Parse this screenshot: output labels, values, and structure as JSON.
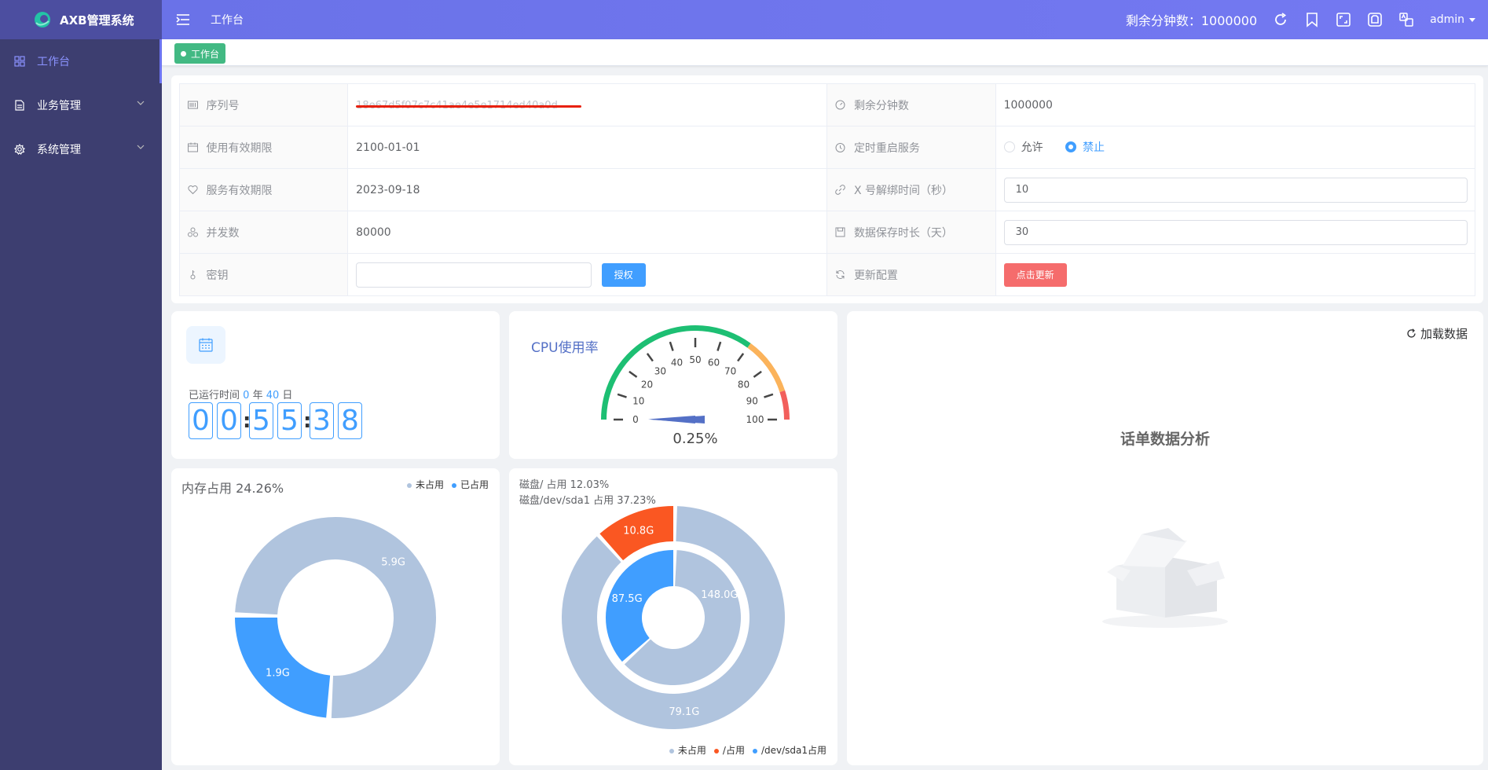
{
  "app": {
    "title": "AXB管理系统"
  },
  "sidebar": {
    "items": [
      {
        "label": "工作台",
        "icon": "dashboard-icon",
        "active": true
      },
      {
        "label": "业务管理",
        "icon": "document-icon",
        "active": false
      },
      {
        "label": "系统管理",
        "icon": "gear-icon",
        "active": false
      }
    ]
  },
  "header": {
    "breadcrumb": "工作台",
    "remaining_minutes": "剩余分钟数：1000000",
    "user": "admin"
  },
  "tags": {
    "active_tag": "工作台"
  },
  "info": {
    "serial_label": "序列号",
    "serial_value": "18e67d5f07c7c41ae4e5e1714ed40a0d",
    "remain_label": "剩余分钟数",
    "remain_value": "1000000",
    "validity_label": "使用有效期限",
    "validity_value": "2100-01-01",
    "restart_label": "定时重启服务",
    "restart_allow": "允许",
    "restart_forbid": "禁止",
    "service_label": "服务有效期限",
    "service_value": "2023-09-18",
    "unbind_label": "X 号解绑时间（秒）",
    "unbind_value": "10",
    "concurrency_label": "并发数",
    "concurrency_value": "80000",
    "retention_label": "数据保存时长（天）",
    "retention_value": "30",
    "key_label": "密钥",
    "key_value": "",
    "authorize_button": "授权",
    "update_label": "更新配置",
    "update_button": "点击更新"
  },
  "runtime": {
    "prefix": "已运行时间",
    "years": "0",
    "year_unit": "年",
    "days": "40",
    "day_unit": "日",
    "digits": [
      "0",
      "0",
      "5",
      "5",
      "3",
      "8"
    ]
  },
  "cpu": {
    "title": "CPU使用率",
    "value_text": "0.25%",
    "value": 0.25,
    "ticks": [
      "0",
      "10",
      "20",
      "30",
      "40",
      "50",
      "60",
      "70",
      "80",
      "90",
      "100"
    ],
    "colors": {
      "low": "#1dbf73",
      "mid": "#fbb35b",
      "high": "#f25f5c",
      "pointer": "#5470c6"
    }
  },
  "memory": {
    "title": "内存占用 24.26%",
    "legend": [
      "未占用",
      "已占用"
    ],
    "unused": "5.9G",
    "used": "1.9G",
    "unused_value": 5.9,
    "used_value": 1.9,
    "colors": {
      "unused": "#b0c4de",
      "used": "#409eff"
    }
  },
  "disk": {
    "title_root": "磁盘/ 占用 12.03%",
    "title_sda1": "磁盘/dev/sda1 占用 37.23%",
    "legend": [
      "未占用",
      "/占用",
      "/dev/sda1占用"
    ],
    "root_used": "10.8G",
    "root_unused": "79.1G",
    "sda1_used": "87.5G",
    "sda1_unused": "148.0G",
    "root_used_value": 10.8,
    "root_unused_value": 79.1,
    "sda1_used_value": 87.5,
    "sda1_unused_value": 148.0,
    "colors": {
      "unused": "#b0c4de",
      "root": "#fa5722",
      "sda1": "#409eff"
    }
  },
  "cdr": {
    "reload": "加载数据",
    "title": "话单数据分析"
  }
}
